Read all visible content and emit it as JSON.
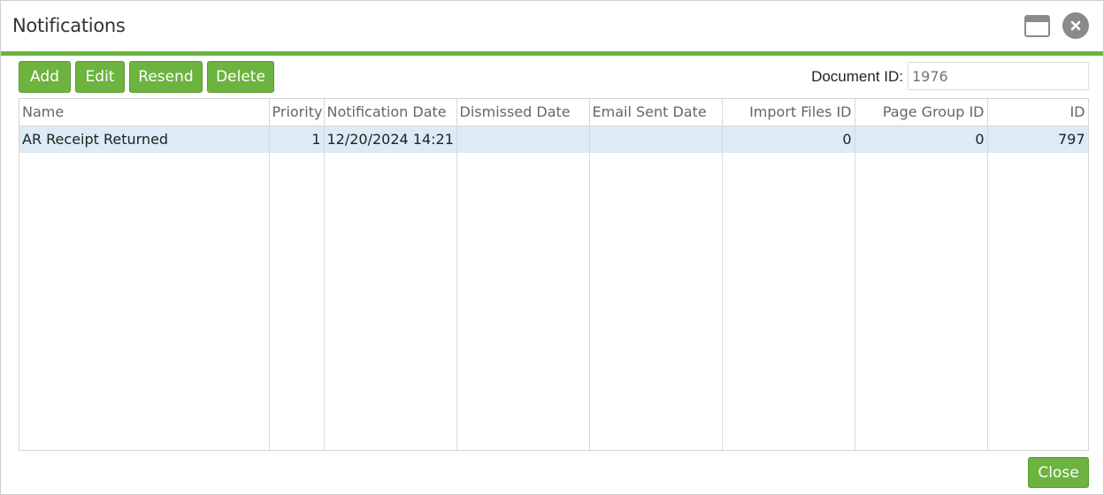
{
  "window": {
    "title": "Notifications",
    "maximize_icon": "window-maximize-icon",
    "close_icon": "close-circle-icon"
  },
  "colors": {
    "accent": "#6cb33f",
    "selected_row": "#dcebf5"
  },
  "toolbar": {
    "add_label": "Add",
    "edit_label": "Edit",
    "resend_label": "Resend",
    "delete_label": "Delete"
  },
  "document_id": {
    "label": "Document ID:",
    "placeholder": "1976"
  },
  "table": {
    "columns": [
      "Name",
      "Priority",
      "Notification Date",
      "Dismissed Date",
      "Email Sent Date",
      "Import Files ID",
      "Page Group ID",
      "ID"
    ],
    "rows": [
      {
        "name": "AR Receipt Returned",
        "priority": "1",
        "notification_date": "12/20/2024 14:21",
        "dismissed_date": "",
        "email_sent_date": "",
        "import_files_id": "0",
        "page_group_id": "0",
        "id": "797"
      }
    ]
  },
  "footer": {
    "close_label": "Close"
  }
}
